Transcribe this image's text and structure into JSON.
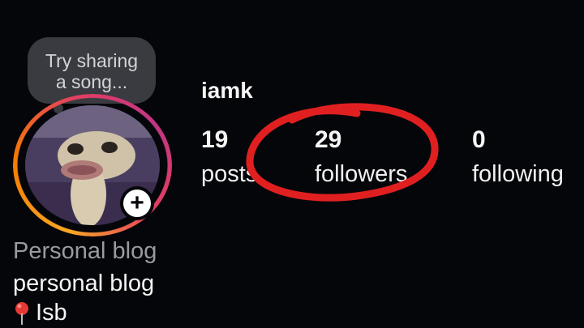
{
  "note": {
    "line1": "Try sharing",
    "line2": "a song..."
  },
  "profile": {
    "username": "iamk",
    "add_icon": "plus-icon"
  },
  "stats": {
    "posts": {
      "count": "19",
      "label": "posts"
    },
    "followers": {
      "count": "29",
      "label": "followers"
    },
    "following": {
      "count": "0",
      "label": "following"
    }
  },
  "bio": {
    "category": "Personal blog",
    "text": "personal blog",
    "location": "Isb",
    "location_icon": "pin-icon"
  },
  "colors": {
    "background": "#05060a",
    "annotation": "#e02020",
    "story_ring": "#f57c00"
  }
}
